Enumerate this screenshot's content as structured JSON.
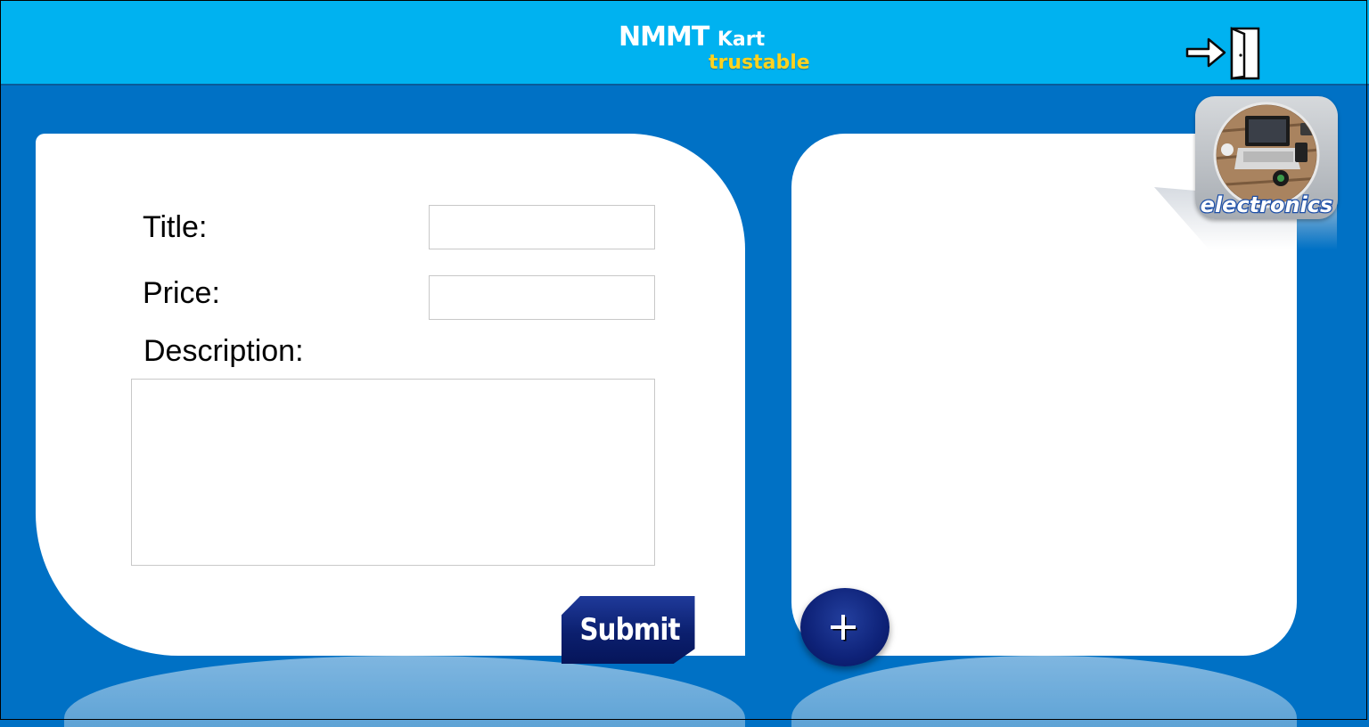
{
  "header": {
    "brand_main": "NMMT",
    "brand_sub": "Kart",
    "tagline": "trustable",
    "logout_icon": "exit-door-icon"
  },
  "form": {
    "title_label": "Title:",
    "price_label": "Price:",
    "description_label": "Description:",
    "title_value": "",
    "price_value": "",
    "description_value": "",
    "submit_label": "Submit"
  },
  "list_panel": {
    "category_label": "electronics",
    "category_icon": "electronics-category-icon",
    "add_icon": "plus-icon"
  },
  "colors": {
    "background": "#0071c5",
    "header": "#00b2f0",
    "brand_text": "#ffffff",
    "tagline": "#ffd21f",
    "button": "#0b1f6e"
  }
}
